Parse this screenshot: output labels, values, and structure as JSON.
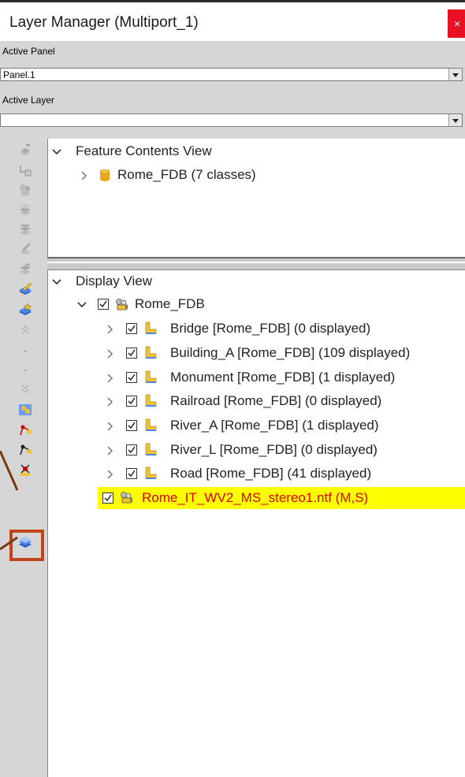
{
  "window": {
    "title": "Layer Manager (Multiport_1)",
    "close_glyph": "×"
  },
  "active_panel": {
    "label": "Active Panel",
    "value": "Panel.1"
  },
  "active_layer": {
    "label": "Active Layer",
    "value": ""
  },
  "feature_view": {
    "header": "Feature Contents View",
    "items": [
      {
        "label": "Rome_FDB  (7 classes)",
        "icon": "database-icon"
      }
    ]
  },
  "display_view": {
    "header": "Display View",
    "root": {
      "label": "Rome_FDB",
      "icon": "model-icon",
      "checked": true
    },
    "layers": [
      {
        "label": "Bridge [Rome_FDB]  (0 displayed)",
        "checked": true,
        "icon": "feature-layer-icon"
      },
      {
        "label": "Building_A [Rome_FDB]  (109 displayed)",
        "checked": true,
        "icon": "feature-layer-icon"
      },
      {
        "label": "Monument [Rome_FDB]  (1 displayed)",
        "checked": true,
        "icon": "feature-layer-icon"
      },
      {
        "label": "Railroad [Rome_FDB]  (0 displayed)",
        "checked": true,
        "icon": "feature-layer-icon"
      },
      {
        "label": "River_A [Rome_FDB]  (1 displayed)",
        "checked": true,
        "icon": "feature-layer-icon"
      },
      {
        "label": "River_L [Rome_FDB]  (0 displayed)",
        "checked": true,
        "icon": "feature-layer-icon"
      },
      {
        "label": "Road [Rome_FDB]  (41 displayed)",
        "checked": true,
        "icon": "feature-layer-icon"
      }
    ],
    "image_layer": {
      "label": "Rome_IT_WV2_MS_stereo1.ntf (M,S)",
      "checked": true,
      "icon": "model-icon",
      "highlight": "#ffff00",
      "text_color": "#e00000"
    }
  },
  "toolbar": {
    "buttons": [
      "add-layer-icon",
      "link-layer-icon",
      "model-layer-icon",
      "stack-layer-icon",
      "stack-edit-icon",
      "stack-pencil-icon",
      "stack-grid-icon",
      "edit-layer-icon",
      "edit-layer-star-icon",
      "move-top-icon",
      "move-up-icon",
      "move-down-icon",
      "move-bottom-icon",
      "image-tool-icon",
      "node-tool-icon",
      "node-tool-2-icon",
      "node-tool-3-icon",
      "layers-icon"
    ],
    "highlight_color": "#c0451a"
  }
}
